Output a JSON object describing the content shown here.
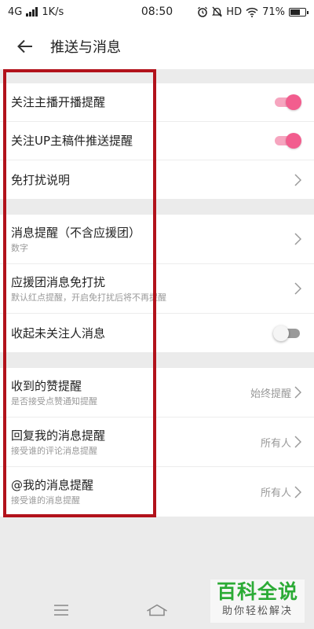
{
  "status_bar": {
    "network": "4G",
    "speed": "1K/s",
    "time": "08:50",
    "hd": "HD",
    "battery_text": "71%",
    "battery_level": 0.71,
    "icons": [
      "signal-icon",
      "alarm-icon",
      "mute-icon",
      "wifi-icon",
      "battery-icon"
    ]
  },
  "header": {
    "title": "推送与消息",
    "back_icon": "back-arrow-icon"
  },
  "groups": [
    {
      "rows": [
        {
          "label": "关注主播开播提醒",
          "control": "toggle",
          "on": true
        },
        {
          "label": "关注UP主稿件推送提醒",
          "control": "toggle",
          "on": true
        },
        {
          "label": "免打扰说明",
          "control": "chevron"
        }
      ]
    },
    {
      "rows": [
        {
          "label": "消息提醒（不含应援团）",
          "sub": "数字",
          "control": "chevron"
        },
        {
          "label": "应援团消息免打扰",
          "sub": "默认红点提醒，开启免打扰后将不再提醒",
          "control": "chevron"
        },
        {
          "label": "收起未关注人消息",
          "control": "toggle",
          "on": false
        }
      ]
    },
    {
      "rows": [
        {
          "label": "收到的赞提醒",
          "sub": "是否接受点赞通知提醒",
          "value": "始终提醒",
          "control": "chevron"
        },
        {
          "label": "回复我的消息提醒",
          "sub": "接受谁的评论消息提醒",
          "value": "所有人",
          "control": "chevron"
        },
        {
          "label": "@我的消息提醒",
          "sub": "接受谁的消息提醒",
          "value": "所有人",
          "control": "chevron"
        }
      ]
    }
  ],
  "colors": {
    "accent": "#f25d8e",
    "highlight": "#b2121b",
    "watermark": "#2cab36"
  },
  "nav": {
    "icons": [
      "menu-icon",
      "home-icon"
    ]
  },
  "watermark": {
    "title": "百科全说",
    "subtitle": "助你轻松解决"
  }
}
